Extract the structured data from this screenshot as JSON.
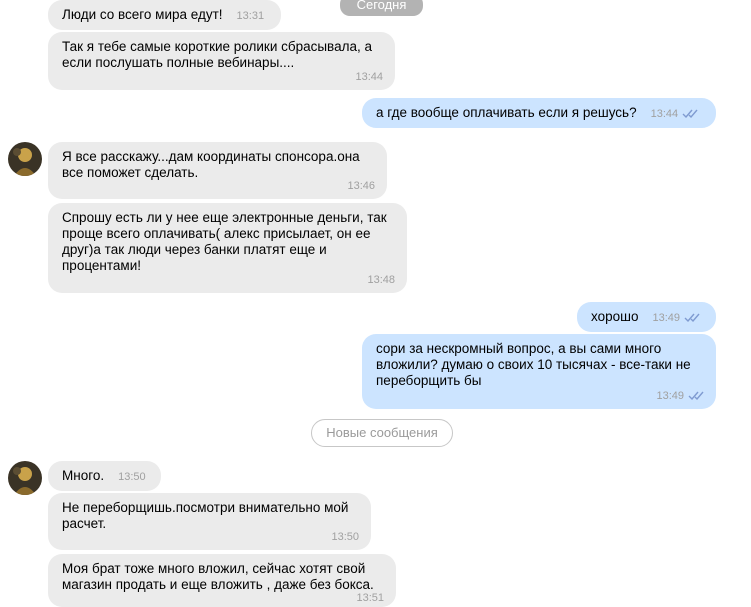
{
  "date_divider": "Сегодня",
  "new_messages_divider": "Новые сообщения",
  "accent_colors": {
    "incoming_bubble": "#ebebeb",
    "outgoing_bubble": "#cce4ff",
    "read_check": "#7f9bd1"
  },
  "messages": [
    {
      "text": "Люди со всего мира едут!",
      "time": "13:31"
    },
    {
      "text": "Так я тебе самые короткие ролики сбрасывала, а если послушать полные вебинары....",
      "time": "13:44"
    },
    {
      "text": "а где вообще оплачивать если я решусь?",
      "time": "13:44",
      "status": "read-icon"
    },
    {
      "text": "Я все расскажу...дам координаты спонсора.она все поможет сделать.",
      "time": "13:46"
    },
    {
      "text": "Спрошу есть ли у нее еще электронные деньги, так проще всего оплачивать( алекс присылает, он ее друг)а так люди через банки платят еще и процентами!",
      "time": "13:48"
    },
    {
      "text": "хорошо",
      "time": "13:49",
      "status": "read-icon"
    },
    {
      "text": "сори за нескромный вопрос, а вы сами много вложили? думаю о своих 10 тысячах - все-таки не переборщить бы",
      "time": "13:49",
      "status": "read-icon"
    },
    {
      "text": "Много.",
      "time": "13:50"
    },
    {
      "text": "Не переборщишь.посмотри внимательно мой расчет.",
      "time": "13:50"
    },
    {
      "text": "Моя брат тоже много вложил, сейчас хотят свой магазин продать и еще вложить , даже без бокса.",
      "time": "13:51"
    }
  ]
}
